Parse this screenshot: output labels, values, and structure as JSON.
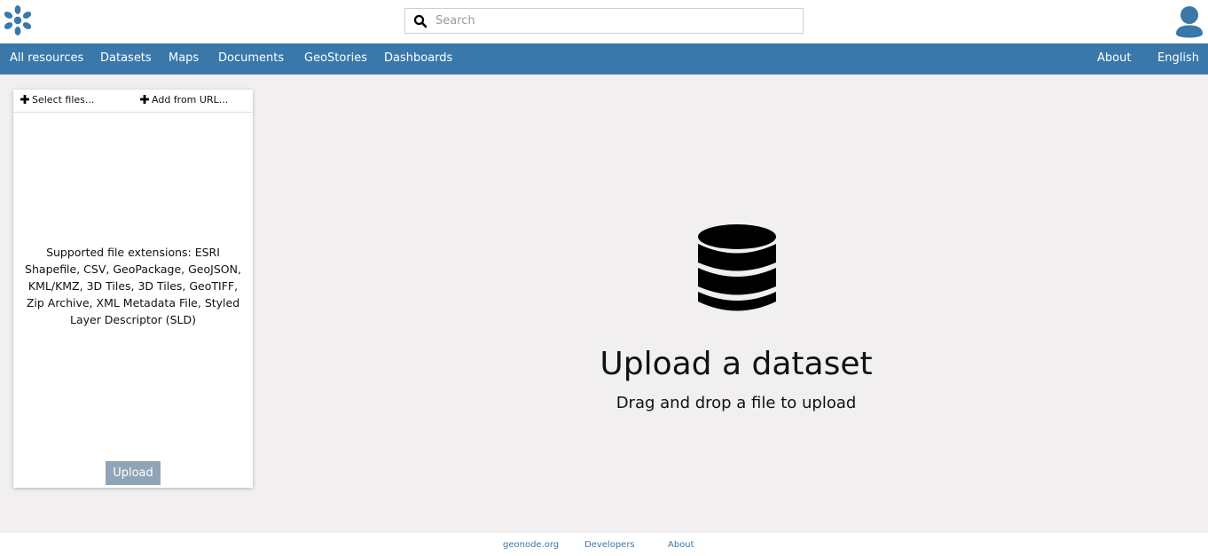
{
  "header": {
    "logo_icon": "geonode-flower-icon",
    "search": {
      "placeholder": "Search",
      "value": ""
    },
    "user_icon": "user-avatar-icon"
  },
  "nav": {
    "left": [
      "All resources",
      "Datasets",
      "Maps",
      "Documents",
      "GeoStories",
      "Dashboards"
    ],
    "right": [
      "About",
      "English"
    ]
  },
  "upload_panel": {
    "select_files": "Select files...",
    "add_from_url": "Add from URL...",
    "supported_text": "Supported file extensions: ESRI Shapefile, CSV, GeoPackage, GeoJSON, KML/KMZ, 3D Tiles, 3D Tiles, GeoTIFF, Zip Archive, XML Metadata File, Styled Layer Descriptor (SLD)",
    "upload_label": "Upload"
  },
  "dropzone": {
    "icon": "database-icon",
    "title": "Upload a dataset",
    "subtitle": "Drag and drop a file to upload"
  },
  "footer": {
    "links": [
      "geonode.org",
      "Developers",
      "About"
    ]
  },
  "colors": {
    "brand": "#3a78aa",
    "background": "#f1eff0",
    "upload_button": "#8fa5b7"
  }
}
